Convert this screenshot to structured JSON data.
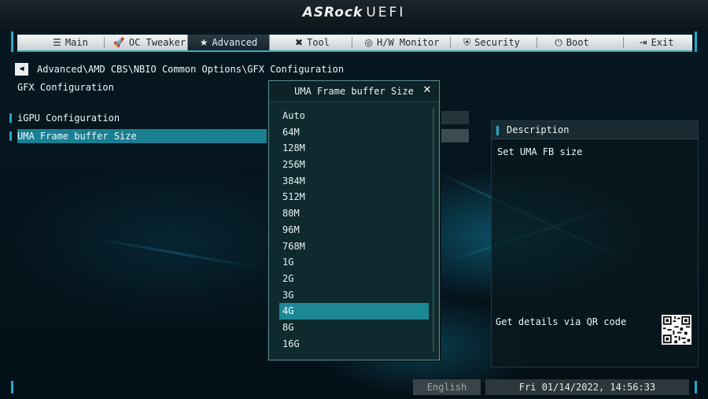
{
  "header": {
    "brand": "ASRock",
    "product": "UEFI"
  },
  "tabs": [
    {
      "label": "Main",
      "icon": "list-icon",
      "glyph": "☰"
    },
    {
      "label": "OC Tweaker",
      "icon": "rocket-icon",
      "glyph": "🚀"
    },
    {
      "label": "Advanced",
      "icon": "star-icon",
      "glyph": "★"
    },
    {
      "label": "Tool",
      "icon": "tools-icon",
      "glyph": "✖"
    },
    {
      "label": "H/W Monitor",
      "icon": "monitor-icon",
      "glyph": "◎"
    },
    {
      "label": "Security",
      "icon": "shield-icon",
      "glyph": "⛨"
    },
    {
      "label": "Boot",
      "icon": "power-icon",
      "glyph": "⏻"
    },
    {
      "label": "Exit",
      "icon": "exit-icon",
      "glyph": "⇥"
    }
  ],
  "active_tab": "Advanced",
  "breadcrumb": "Advanced\\AMD CBS\\NBIO Common Options\\GFX Configuration",
  "page_title": "GFX Configuration",
  "menu": [
    {
      "label": "iGPU Configuration"
    },
    {
      "label": "UMA Frame buffer Size"
    }
  ],
  "popup": {
    "title": "UMA Frame buffer Size",
    "options": [
      "Auto",
      "64M",
      "128M",
      "256M",
      "384M",
      "512M",
      "80M",
      "96M",
      "768M",
      "1G",
      "2G",
      "3G",
      "4G",
      "8G",
      "16G"
    ],
    "selected": "4G"
  },
  "description": {
    "heading": "Description",
    "text": "Set UMA FB size",
    "qr_label": "Get details via QR code"
  },
  "status": {
    "language": "English",
    "datetime": "Fri 01/14/2022, 14:56:33"
  },
  "colors": {
    "accent": "#29a9c8",
    "selection": "#1d8895"
  }
}
